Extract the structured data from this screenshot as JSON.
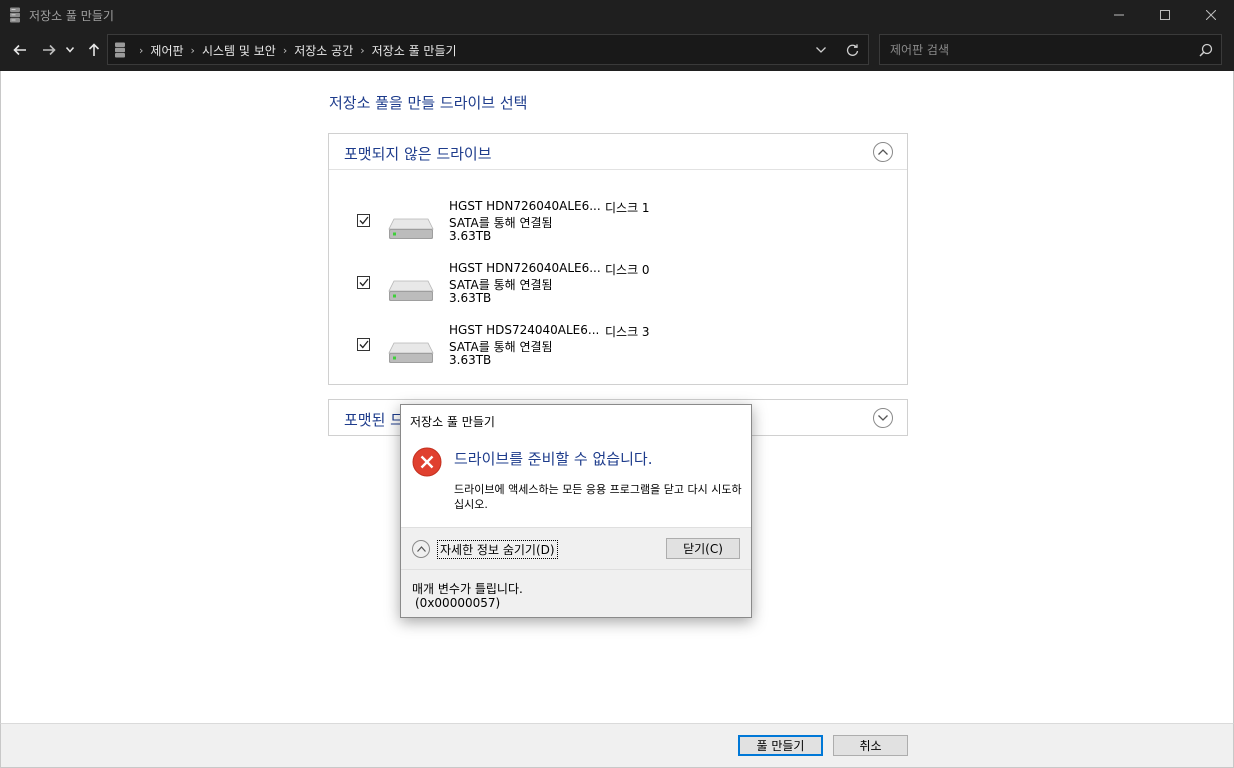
{
  "window": {
    "title": "저장소 풀 만들기"
  },
  "nav": {
    "breadcrumbs": [
      "제어판",
      "시스템 및 보안",
      "저장소 공간",
      "저장소 풀 만들기"
    ],
    "search_placeholder": "제어판 검색"
  },
  "main": {
    "heading": "저장소 풀을 만들 드라이브 선택",
    "unformatted_group": {
      "title": "포맷되지 않은 드라이브",
      "drives": [
        {
          "name": "HGST HDN726040ALE6...",
          "connection": "SATA를 통해 연결됨",
          "size": "3.63TB",
          "disk": "디스크 1",
          "checked": true
        },
        {
          "name": "HGST HDN726040ALE6...",
          "connection": "SATA를 통해 연결됨",
          "size": "3.63TB",
          "disk": "디스크 0",
          "checked": true
        },
        {
          "name": "HGST HDS724040ALE6...",
          "connection": "SATA를 통해 연결됨",
          "size": "3.63TB",
          "disk": "디스크 3",
          "checked": true
        }
      ]
    },
    "formatted_group": {
      "title": "포맷된 드라이브"
    }
  },
  "footer": {
    "create_label": "풀 만들기",
    "cancel_label": "취소"
  },
  "dialog": {
    "title": "저장소 풀 만들기",
    "main_message": "드라이브를 준비할 수 없습니다.",
    "sub_message": "드라이브에 액세스하는 모든 응용 프로그램을 닫고 다시 시도하십시오.",
    "details_toggle_label": "자세한 정보 숨기기(D)",
    "close_label": "닫기(C)",
    "details_line1": "매개 변수가 틀립니다.",
    "details_line2": "(0x00000057)"
  },
  "colors": {
    "heading_blue": "#1e3c8c",
    "error_red": "#e0402f",
    "accent": "#0078d7"
  }
}
